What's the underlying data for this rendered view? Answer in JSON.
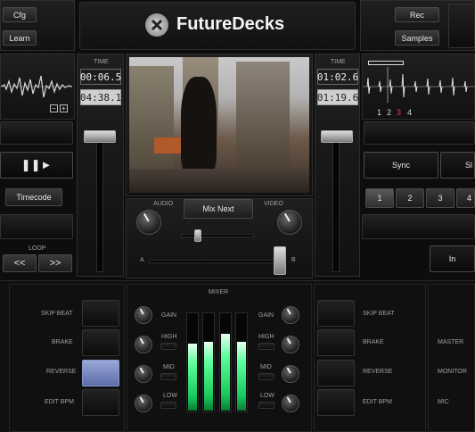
{
  "app": {
    "title": "FutureDecks"
  },
  "top_left": {
    "cfg_label": "Cfg",
    "learn_label": "Learn"
  },
  "top_right": {
    "rec_label": "Rec",
    "samples_label": "Samples"
  },
  "deck_a": {
    "time_label": "TIME",
    "elapsed": "00:06.5",
    "remaining": "04:38.1",
    "play_glyph": "❚❚►",
    "timecode_label": "Timecode",
    "loop_label": "LOOP",
    "loop_back": "<<",
    "loop_fwd": ">>",
    "zoom_out": "−",
    "zoom_in": "+"
  },
  "deck_b": {
    "time_label": "TIME",
    "elapsed": "01:02.6",
    "remaining": "01:19.6",
    "cue_numbers": [
      "1",
      "2",
      "3",
      "4"
    ],
    "active_cue": "3",
    "sync_label": "Sync",
    "sync_cut": "Sl",
    "hotcues": [
      "1",
      "2",
      "3",
      "4"
    ],
    "in_label": "In"
  },
  "center": {
    "audio_label": "AUDIO",
    "video_label": "VIDEO",
    "mix_next_label": "Mix Next",
    "crossfader_a": "A",
    "crossfader_b": "B",
    "mini_fader_level": 0.2,
    "crossfader_level": 0.92
  },
  "mixer": {
    "title": "MIXER",
    "left_buttons": [
      "SKIP BEAT",
      "BRAKE",
      "REVERSE",
      "EDIT BPM"
    ],
    "right_buttons": [
      "SKIP BEAT",
      "BRAKE",
      "REVERSE",
      "EDIT BPM"
    ],
    "eq_left": [
      "GAIN",
      "HIGH",
      "MID",
      "LOW"
    ],
    "eq_right": [
      "GAIN",
      "HIGH",
      "MID",
      "LOW"
    ],
    "master_labels": [
      "MASTER",
      "MONITOR",
      "MIC"
    ],
    "meter_levels": [
      0.7,
      0.72,
      0.8,
      0.72
    ],
    "reverse_active": true
  },
  "colors": {
    "accent_red": "#e04030",
    "meter_green": "#3cff80",
    "active_blue": "#7c8ec8"
  },
  "icons": {
    "logo": "x-circle-logo-icon",
    "play": "play-pause-icon"
  }
}
